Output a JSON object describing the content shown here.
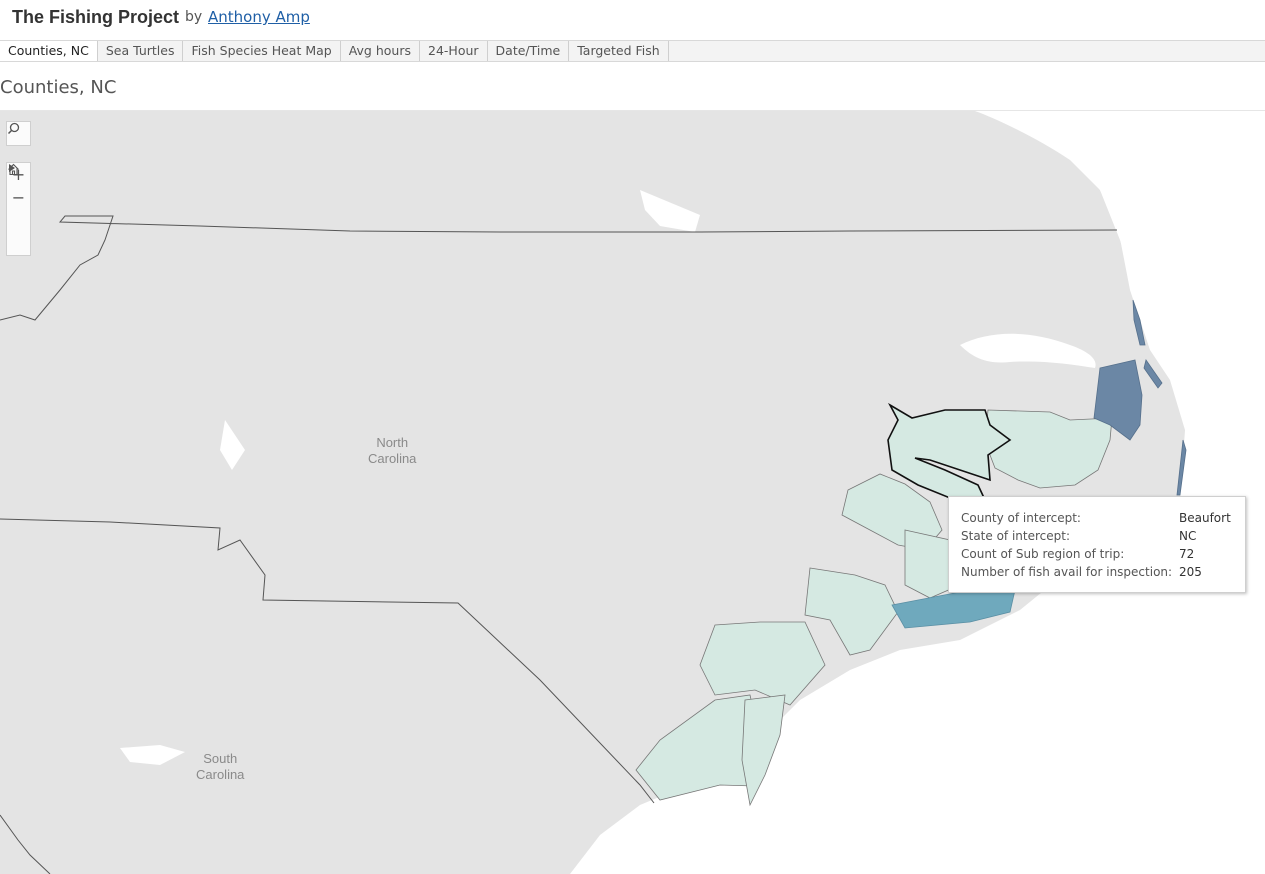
{
  "header": {
    "title": "The Fishing Project",
    "by": "by",
    "author": "Anthony Amp"
  },
  "tabs": [
    {
      "label": "Counties, NC",
      "active": true
    },
    {
      "label": "Sea Turtles",
      "active": false
    },
    {
      "label": "Fish Species Heat Map",
      "active": false
    },
    {
      "label": "Avg hours",
      "active": false
    },
    {
      "label": "24-Hour",
      "active": false
    },
    {
      "label": "Date/Time",
      "active": false
    },
    {
      "label": "Targeted Fish",
      "active": false
    }
  ],
  "sheet": {
    "title": "Counties, NC"
  },
  "map": {
    "labels": {
      "north_carolina": [
        "North",
        "Carolina"
      ],
      "south_carolina": [
        "South",
        "Carolina"
      ]
    },
    "colors": {
      "land": "#e4e4e4",
      "water": "#ffffff",
      "county_light": "#d5e9e2",
      "county_medium": "#6fa9bd",
      "county_dark": "#6b87a5",
      "border": "#555555"
    },
    "toolbar": {
      "search": "search-icon",
      "zoom_in": "+",
      "zoom_out": "−",
      "home": "home-icon",
      "expand": "play-icon"
    }
  },
  "tooltip": {
    "rows": [
      {
        "key": "County of intercept:",
        "value": "Beaufort"
      },
      {
        "key": "State of intercept:",
        "value": "NC"
      },
      {
        "key": "Count of Sub region of trip:",
        "value": "72"
      },
      {
        "key": "Number of fish avail for inspection:",
        "value": "205"
      }
    ]
  }
}
